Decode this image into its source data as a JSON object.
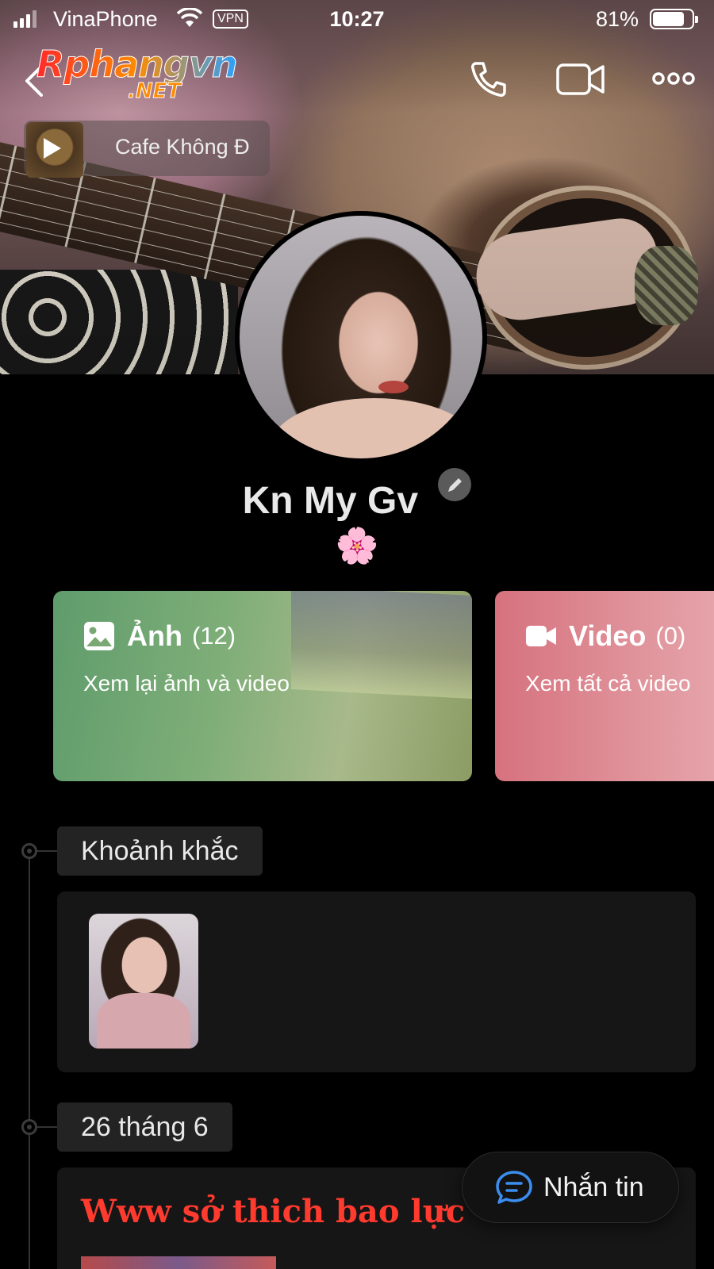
{
  "status_bar": {
    "carrier": "VinaPhone",
    "vpn": "VPN",
    "time": "10:27",
    "battery_percent": "81%",
    "battery_level": 0.81
  },
  "watermark": {
    "main": "Rphangvn",
    "sub": ".NET"
  },
  "music": {
    "title": "Cafe Không Đ"
  },
  "profile": {
    "name": "Kn My Gv",
    "status_emoji": "🌸"
  },
  "media_cards": [
    {
      "title": "Ảnh",
      "count": "(12)",
      "description": "Xem lại ảnh và video",
      "icon": "image-icon"
    },
    {
      "title": "Video",
      "count": "(0)",
      "description": "Xem tất cả video",
      "icon": "video-camera-icon"
    }
  ],
  "timeline": {
    "sections": [
      {
        "label": "Khoảnh khắc"
      },
      {
        "label": "26 tháng 6"
      }
    ],
    "post_text": "Www sở thich bao lực"
  },
  "message_button": {
    "label": "Nhắn tin",
    "icon": "chat-bubble-icon"
  },
  "colors": {
    "photo_card": "#7fae78",
    "video_card": "#e0939b",
    "post_text": "#ff3a2e",
    "chat_icon": "#3b8ef0"
  }
}
